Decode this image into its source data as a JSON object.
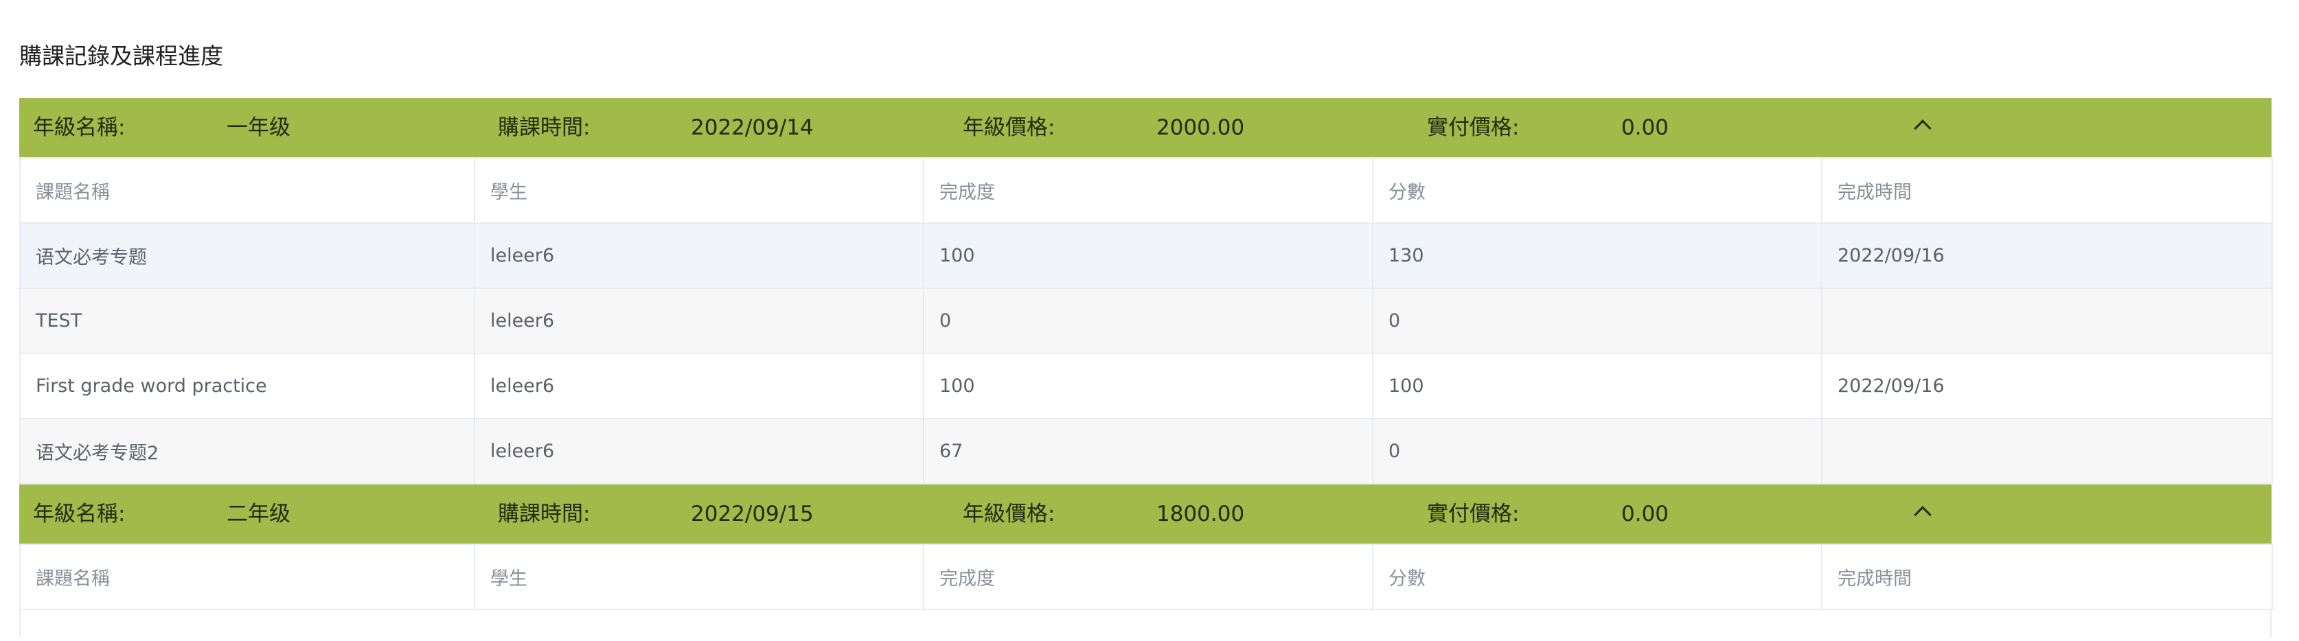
{
  "page_title": "購課記錄及課程進度",
  "labels": {
    "grade_name": "年級名稱:",
    "purchase_time": "購課時間:",
    "grade_price": "年級價格:",
    "paid_price": "實付價格:"
  },
  "columns": [
    "課題名稱",
    "學生",
    "完成度",
    "分數",
    "完成時間"
  ],
  "records": [
    {
      "grade_name": "一年级",
      "purchase_time": "2022/09/14",
      "grade_price": "2000.00",
      "paid_price": "0.00",
      "expanded": true,
      "toggle_icon": "chevron-up-icon",
      "rows": [
        [
          "语文必考专题",
          "leleer6",
          "100",
          "130",
          "2022/09/16"
        ],
        [
          "TEST",
          "leleer6",
          "0",
          "0",
          ""
        ],
        [
          "First grade word practice",
          "leleer6",
          "100",
          "100",
          "2022/09/16"
        ],
        [
          "语文必考专题2",
          "leleer6",
          "67",
          "0",
          ""
        ]
      ]
    },
    {
      "grade_name": "二年级",
      "purchase_time": "2022/09/15",
      "grade_price": "1800.00",
      "paid_price": "0.00",
      "expanded": true,
      "toggle_icon": "chevron-up-icon",
      "rows": []
    }
  ],
  "colors": {
    "header_bar": "#a0bb49",
    "border": "#e8ebef",
    "row_tint": "#f1f5f9"
  }
}
